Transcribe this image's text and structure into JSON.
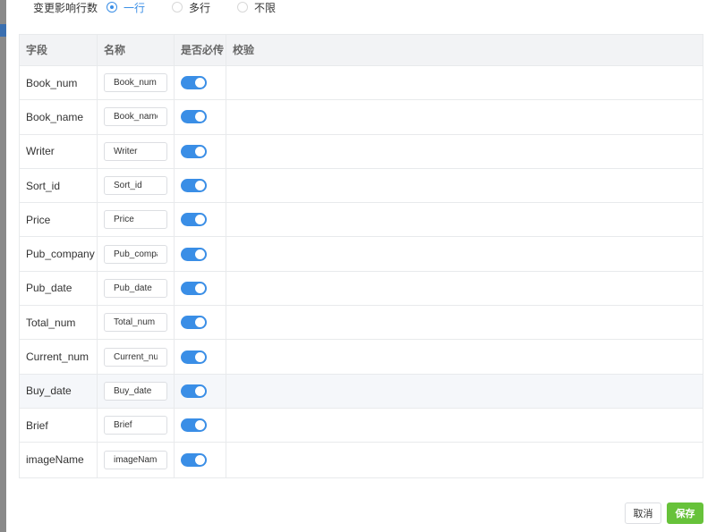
{
  "radio_group": {
    "label": "变更影响行数",
    "options": [
      {
        "label": "一行",
        "checked": true
      },
      {
        "label": "多行",
        "checked": false
      },
      {
        "label": "不限",
        "checked": false
      }
    ]
  },
  "table": {
    "headers": [
      "字段",
      "名称",
      "是否必传",
      "校验"
    ],
    "rows": [
      {
        "field": "Book_num",
        "name": "Book_num",
        "required": true
      },
      {
        "field": "Book_name",
        "name": "Book_name",
        "required": true
      },
      {
        "field": "Writer",
        "name": "Writer",
        "required": true
      },
      {
        "field": "Sort_id",
        "name": "Sort_id",
        "required": true
      },
      {
        "field": "Price",
        "name": "Price",
        "required": true
      },
      {
        "field": "Pub_company",
        "name": "Pub_company",
        "required": true
      },
      {
        "field": "Pub_date",
        "name": "Pub_date",
        "required": true
      },
      {
        "field": "Total_num",
        "name": "Total_num",
        "required": true
      },
      {
        "field": "Current_num",
        "name": "Current_num",
        "required": true
      },
      {
        "field": "Buy_date",
        "name": "Buy_date",
        "required": true
      },
      {
        "field": "Brief",
        "name": "Brief",
        "required": true
      },
      {
        "field": "imageName",
        "name": "imageName",
        "required": true
      }
    ]
  },
  "footer": {
    "cancel_label": "取消",
    "save_label": "保存"
  },
  "colors": {
    "accent": "#3a8ee6",
    "save": "#67c23a",
    "header_bg": "#f2f3f5"
  }
}
